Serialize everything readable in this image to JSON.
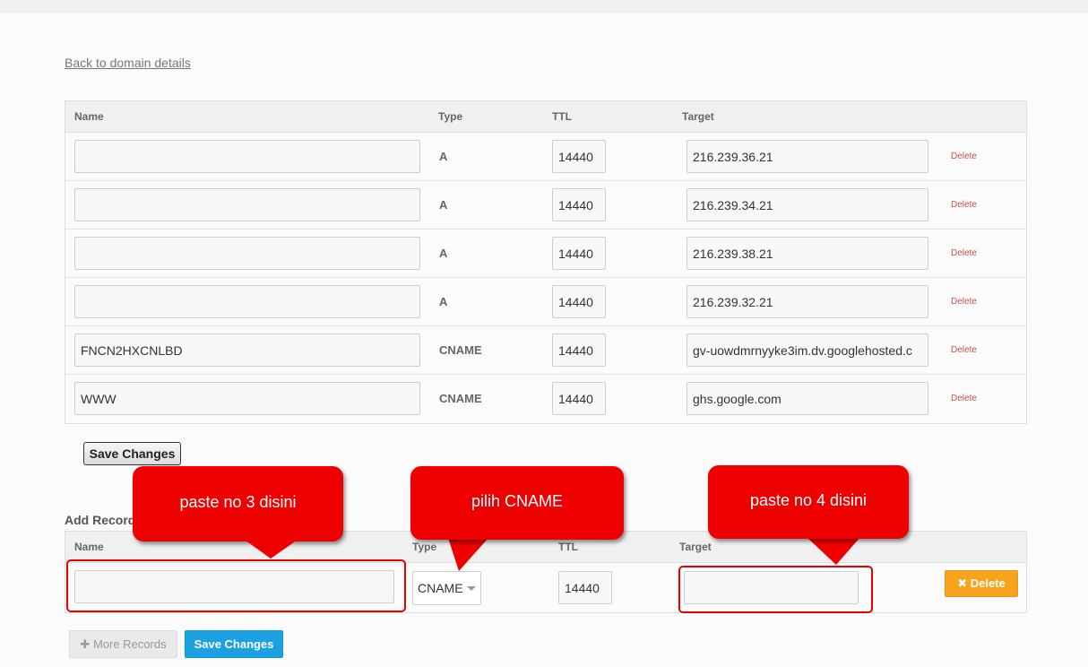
{
  "back_link": "Back to domain details",
  "records_table": {
    "headers": {
      "name": "Name",
      "type": "Type",
      "ttl": "TTL",
      "target": "Target"
    },
    "rows": [
      {
        "name": "",
        "type": "A",
        "ttl": "14440",
        "target": "216.239.36.21",
        "delete": "Delete"
      },
      {
        "name": "",
        "type": "A",
        "ttl": "14440",
        "target": "216.239.34.21",
        "delete": "Delete"
      },
      {
        "name": "",
        "type": "A",
        "ttl": "14440",
        "target": "216.239.38.21",
        "delete": "Delete"
      },
      {
        "name": "",
        "type": "A",
        "ttl": "14440",
        "target": "216.239.32.21",
        "delete": "Delete"
      },
      {
        "name": "FNCN2HXCNLBD",
        "type": "CNAME",
        "ttl": "14440",
        "target": "gv-uowdmrnyyke3im.dv.googlehosted.c",
        "delete": "Delete"
      },
      {
        "name": "WWW",
        "type": "CNAME",
        "ttl": "14440",
        "target": "ghs.google.com",
        "delete": "Delete"
      }
    ]
  },
  "save_changes_label": "Save Changes",
  "add_records": {
    "heading": "Add Records",
    "headers": {
      "name": "Name",
      "type": "Type",
      "ttl": "TTL",
      "target": "Target"
    },
    "row": {
      "name": "",
      "type": "CNAME",
      "ttl": "14440",
      "target": "",
      "delete_label": "Delete",
      "delete_icon": "times-icon"
    }
  },
  "more_records": {
    "label": "More Records",
    "icon": "plus-icon"
  },
  "save_changes_2_label": "Save Changes",
  "callouts": [
    {
      "text": "paste no 3 disini"
    },
    {
      "text": "pilih CNAME"
    },
    {
      "text": "paste no 4 disini"
    }
  ],
  "colors": {
    "callout_red": "#ee0000",
    "delete_orange": "#f7a31c",
    "save_blue": "#1ba1e2",
    "delete_link": "#c0504d"
  }
}
